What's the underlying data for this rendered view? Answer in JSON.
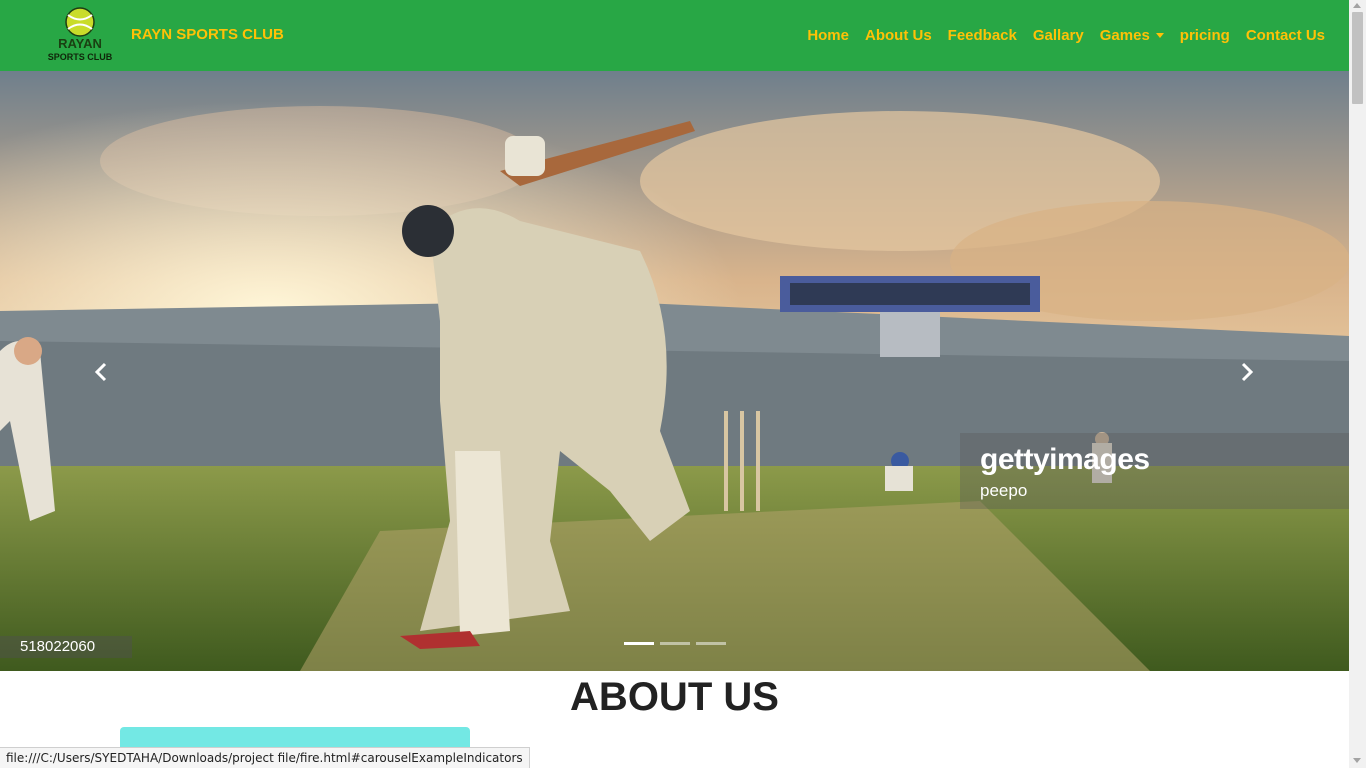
{
  "navbar": {
    "logo_text_top": "RAYAN",
    "logo_text_bottom": "SPORTS CLUB",
    "brand": "RAYN SPORTS CLUB",
    "links": [
      "Home",
      "About Us",
      "Feedback",
      "Gallary",
      "Games",
      "pricing",
      "Contact Us"
    ]
  },
  "carousel": {
    "watermark_brand": "gettyimages",
    "watermark_user": "peepo",
    "image_id": "518022060",
    "slide_count": 3,
    "active_slide": 1
  },
  "about": {
    "title": "ABOUT US"
  },
  "status_bar": {
    "url": "file:///C:/Users/SYEDTAHA/Downloads/project file/fire.html#carouselExampleIndicators"
  },
  "colors": {
    "navbar_bg": "#28a745",
    "nav_text": "#ffc107",
    "card_bg": "#73e8e4"
  }
}
